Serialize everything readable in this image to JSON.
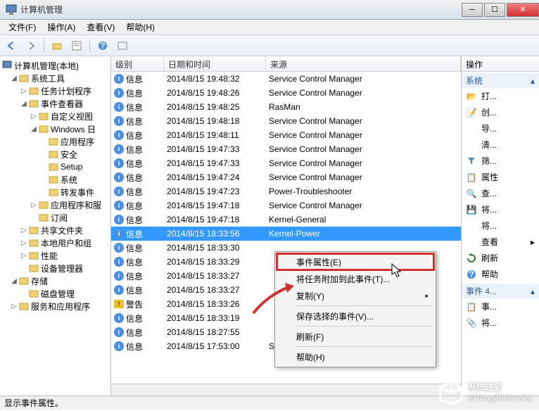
{
  "window": {
    "title": "计算机管理"
  },
  "menu": {
    "file": "文件(F)",
    "action": "操作(A)",
    "view": "查看(V)",
    "help": "帮助(H)"
  },
  "tree": {
    "root": "计算机管理(本地)",
    "items": [
      {
        "label": "系统工具",
        "indent": 1,
        "exp": "◢",
        "icon": "wrench"
      },
      {
        "label": "任务计划程序",
        "indent": 2,
        "exp": "▷",
        "icon": "clock"
      },
      {
        "label": "事件查看器",
        "indent": 2,
        "exp": "◢",
        "icon": "event"
      },
      {
        "label": "自定义视图",
        "indent": 3,
        "exp": "▷",
        "icon": "folder"
      },
      {
        "label": "Windows 日",
        "indent": 3,
        "exp": "◢",
        "icon": "folder"
      },
      {
        "label": "应用程序",
        "indent": 4,
        "exp": "",
        "icon": "log"
      },
      {
        "label": "安全",
        "indent": 4,
        "exp": "",
        "icon": "log"
      },
      {
        "label": "Setup",
        "indent": 4,
        "exp": "",
        "icon": "log"
      },
      {
        "label": "系统",
        "indent": 4,
        "exp": "",
        "icon": "log",
        "sel": false
      },
      {
        "label": "转发事件",
        "indent": 4,
        "exp": "",
        "icon": "log"
      },
      {
        "label": "应用程序和服",
        "indent": 3,
        "exp": "▷",
        "icon": "folder"
      },
      {
        "label": "订阅",
        "indent": 3,
        "exp": "",
        "icon": "sub"
      },
      {
        "label": "共享文件夹",
        "indent": 2,
        "exp": "▷",
        "icon": "share"
      },
      {
        "label": "本地用户和组",
        "indent": 2,
        "exp": "▷",
        "icon": "users"
      },
      {
        "label": "性能",
        "indent": 2,
        "exp": "▷",
        "icon": "perf"
      },
      {
        "label": "设备管理器",
        "indent": 2,
        "exp": "",
        "icon": "device"
      },
      {
        "label": "存储",
        "indent": 1,
        "exp": "◢",
        "icon": "storage"
      },
      {
        "label": "磁盘管理",
        "indent": 2,
        "exp": "",
        "icon": "disk"
      },
      {
        "label": "服务和应用程序",
        "indent": 1,
        "exp": "▷",
        "icon": "services"
      }
    ]
  },
  "columns": {
    "level": "级别",
    "datetime": "日期和时间",
    "source": "来源"
  },
  "events": [
    {
      "type": "info",
      "level": "信息",
      "date": "2014/8/15 19:48:32",
      "source": "Service Control Manager"
    },
    {
      "type": "info",
      "level": "信息",
      "date": "2014/8/15 19:48:26",
      "source": "Service Control Manager"
    },
    {
      "type": "info",
      "level": "信息",
      "date": "2014/8/15 19:48:25",
      "source": "RasMan"
    },
    {
      "type": "info",
      "level": "信息",
      "date": "2014/8/15 19:48:18",
      "source": "Service Control Manager"
    },
    {
      "type": "info",
      "level": "信息",
      "date": "2014/8/15 19:48:11",
      "source": "Service Control Manager"
    },
    {
      "type": "info",
      "level": "信息",
      "date": "2014/8/15 19:47:33",
      "source": "Service Control Manager"
    },
    {
      "type": "info",
      "level": "信息",
      "date": "2014/8/15 19:47:33",
      "source": "Service Control Manager"
    },
    {
      "type": "info",
      "level": "信息",
      "date": "2014/8/15 19:47:24",
      "source": "Service Control Manager"
    },
    {
      "type": "info",
      "level": "信息",
      "date": "2014/8/15 19:47:23",
      "source": "Power-Troubleshooter"
    },
    {
      "type": "info",
      "level": "信息",
      "date": "2014/8/15 19:47:18",
      "source": "Service Control Manager"
    },
    {
      "type": "info",
      "level": "信息",
      "date": "2014/8/15 19:47:18",
      "source": "Kernel-General"
    },
    {
      "type": "info",
      "level": "信息",
      "date": "2014/8/15 18:33:56",
      "source": "Kernel-Power",
      "sel": true
    },
    {
      "type": "info",
      "level": "信息",
      "date": "2014/8/15 18:33:30",
      "source": ""
    },
    {
      "type": "info",
      "level": "信息",
      "date": "2014/8/15 18:33:29",
      "source": ""
    },
    {
      "type": "info",
      "level": "信息",
      "date": "2014/8/15 18:33:27",
      "source": ""
    },
    {
      "type": "info",
      "level": "信息",
      "date": "2014/8/15 18:33:27",
      "source": ""
    },
    {
      "type": "warn",
      "level": "警告",
      "date": "2014/8/15 18:33:26",
      "source": ""
    },
    {
      "type": "info",
      "level": "信息",
      "date": "2014/8/15 18:33:19",
      "source": ""
    },
    {
      "type": "info",
      "level": "信息",
      "date": "2014/8/15 18:27:55",
      "source": ""
    },
    {
      "type": "info",
      "level": "信息",
      "date": "2014/8/15 17:53:00",
      "source": "Service Control Manager"
    }
  ],
  "context": {
    "props": "事件属性(E)",
    "attach": "将任务附加到此事件(T)...",
    "copy": "复制(Y)",
    "saveSel": "保存选择的事件(V)...",
    "refresh": "刷新(F)",
    "help": "帮助(H)"
  },
  "actions": {
    "header": "操作",
    "group1": "系统",
    "open": "打...",
    "create": "创...",
    "import": "导...",
    "clear": "清...",
    "filter": "筛...",
    "properties": "属性",
    "find": "查...",
    "save": "将...",
    "attach": "将...",
    "view": "查看",
    "refresh": "刷新",
    "help": "帮助",
    "group2": "事件 4...",
    "evtProps": "事...",
    "evtAttach": "将..."
  },
  "status": "显示事件属性。",
  "watermark": {
    "brand": "系统之家",
    "url": "XiTongZhiJia.Net"
  }
}
